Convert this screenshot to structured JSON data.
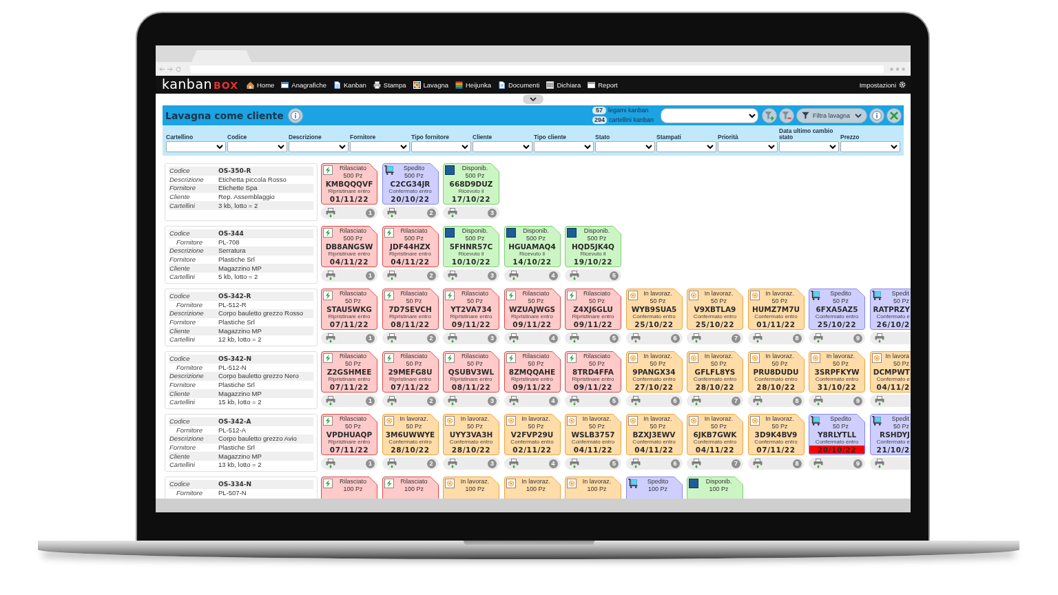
{
  "nav": {
    "logo": {
      "text": "kanban",
      "accent": "BOX"
    },
    "items": [
      {
        "kind": "home",
        "label": "Home"
      },
      {
        "kind": "registry",
        "label": "Anagrafiche"
      },
      {
        "kind": "kanban",
        "label": "Kanban"
      },
      {
        "kind": "print",
        "label": "Stampa"
      },
      {
        "kind": "board",
        "label": "Lavagna"
      },
      {
        "kind": "heijunka",
        "label": "Heijunka"
      },
      {
        "kind": "documents",
        "label": "Documenti"
      },
      {
        "kind": "declare",
        "label": "Dichiara"
      },
      {
        "kind": "report",
        "label": "Report"
      }
    ],
    "settings": {
      "label": "Impostazioni"
    }
  },
  "panel": {
    "title": "Lavagna come cliente",
    "counters": [
      {
        "count": "57",
        "text": "legami kanban"
      },
      {
        "count": "294",
        "text": "cartellini kanban"
      }
    ],
    "filter_button": {
      "label": "Filtra lavagna"
    },
    "filters": [
      {
        "label": "Cartellino"
      },
      {
        "label": "Codice"
      },
      {
        "label": "Descrizione"
      },
      {
        "label": "Fornitore"
      },
      {
        "label": "Tipo fornitore"
      },
      {
        "label": "Cliente"
      },
      {
        "label": "Tipo cliente"
      },
      {
        "label": "Stato"
      },
      {
        "label": "Stampati"
      },
      {
        "label": "Priorità"
      },
      {
        "label": "Data ultimo cambio stato"
      },
      {
        "label": "Prezzo"
      }
    ]
  },
  "rows": [
    {
      "fields": [
        {
          "label": "Codice",
          "value": "OS-350-R",
          "indented": false
        },
        {
          "label": "Descrizione",
          "value": "Etichetta piccola Rosso",
          "indented": false
        },
        {
          "label": "Fornitore",
          "value": "Etichette Spa",
          "indented": false
        },
        {
          "label": "Cliente",
          "value": "Rep. Assemblaggio",
          "indented": false
        },
        {
          "label": "Cartellini",
          "value": "3 kb, lotto = 2",
          "indented": false
        }
      ],
      "cards": [
        {
          "kind": "released",
          "status": "Rilasciato",
          "quantity": "500 Pz",
          "code": "KMBQQQVF",
          "date_label": "Ripristinare entro",
          "date": "01/11/22",
          "overdue": false,
          "number": "1"
        },
        {
          "kind": "shipped",
          "status": "Spedito",
          "quantity": "500 Pz",
          "code": "C2CG34JR",
          "date_label": "Confermato entro",
          "date": "20/10/22",
          "overdue": false,
          "number": "2"
        },
        {
          "kind": "available",
          "status": "Disponib.",
          "quantity": "500 Pz",
          "code": "668D9DUZ",
          "date_label": "Ricevuto il",
          "date": "17/10/22",
          "overdue": false,
          "number": "3"
        }
      ]
    },
    {
      "fields": [
        {
          "label": "Codice",
          "value": "OS-344",
          "indented": false
        },
        {
          "label": "Fornitore",
          "value": "PL-708",
          "indented": true
        },
        {
          "label": "Descrizione",
          "value": "Serratura",
          "indented": false
        },
        {
          "label": "Fornitore",
          "value": "Plastiche Srl",
          "indented": false
        },
        {
          "label": "Cliente",
          "value": "Magazzino MP",
          "indented": false
        },
        {
          "label": "Cartellini",
          "value": "5 kb, lotto = 2",
          "indented": false
        }
      ],
      "cards": [
        {
          "kind": "released",
          "status": "Rilasciato",
          "quantity": "500 Pz",
          "code": "DB8ANGSW",
          "date_label": "Ripristinare entro",
          "date": "04/11/22",
          "overdue": false,
          "number": "1"
        },
        {
          "kind": "released",
          "status": "Rilasciato",
          "quantity": "500 Pz",
          "code": "JDF44HZX",
          "date_label": "Ripristinare entro",
          "date": "04/11/22",
          "overdue": false,
          "number": "2"
        },
        {
          "kind": "available",
          "status": "Disponib.",
          "quantity": "500 Pz",
          "code": "5FHNR57C",
          "date_label": "Ricevuto il",
          "date": "10/10/22",
          "overdue": false,
          "number": "3"
        },
        {
          "kind": "available",
          "status": "Disponib.",
          "quantity": "500 Pz",
          "code": "HGUAMAQ4",
          "date_label": "Ricevuto il",
          "date": "14/10/22",
          "overdue": false,
          "number": "4"
        },
        {
          "kind": "available",
          "status": "Disponib.",
          "quantity": "500 Pz",
          "code": "HQD5JK4Q",
          "date_label": "Ricevuto il",
          "date": "19/10/22",
          "overdue": false,
          "number": "5"
        }
      ]
    },
    {
      "fields": [
        {
          "label": "Codice",
          "value": "OS-342-R",
          "indented": false
        },
        {
          "label": "Fornitore",
          "value": "PL-512-R",
          "indented": true
        },
        {
          "label": "Descrizione",
          "value": "Corpo bauletto grezzo Rosso",
          "indented": false
        },
        {
          "label": "Fornitore",
          "value": "Plastiche Srl",
          "indented": false
        },
        {
          "label": "Cliente",
          "value": "Magazzino MP",
          "indented": false
        },
        {
          "label": "Cartellini",
          "value": "12 kb, lotto = 2",
          "indented": false
        }
      ],
      "cards": [
        {
          "kind": "released",
          "status": "Rilasciato",
          "quantity": "50 Pz",
          "code": "STAU5WKG",
          "date_label": "Ripristinare entro",
          "date": "07/11/22",
          "overdue": false,
          "number": "1"
        },
        {
          "kind": "released",
          "status": "Rilasciato",
          "quantity": "50 Pz",
          "code": "7D7SEVCH",
          "date_label": "Ripristinare entro",
          "date": "08/11/22",
          "overdue": false,
          "number": "2"
        },
        {
          "kind": "released",
          "status": "Rilasciato",
          "quantity": "50 Pz",
          "code": "YT2VA734",
          "date_label": "Ripristinare entro",
          "date": "09/11/22",
          "overdue": false,
          "number": "3"
        },
        {
          "kind": "released",
          "status": "Rilasciato",
          "quantity": "50 Pz",
          "code": "WZUAJWGS",
          "date_label": "Ripristinare entro",
          "date": "09/11/22",
          "overdue": false,
          "number": "4"
        },
        {
          "kind": "released",
          "status": "Rilasciato",
          "quantity": "50 Pz",
          "code": "Z4XJ6GLU",
          "date_label": "Ripristinare entro",
          "date": "09/11/22",
          "overdue": false,
          "number": "5"
        },
        {
          "kind": "wip",
          "status": "In lavoraz.",
          "quantity": "50 Pz",
          "code": "WYB9SUA5",
          "date_label": "Confermato entro",
          "date": "25/10/22",
          "overdue": false,
          "number": "6"
        },
        {
          "kind": "wip",
          "status": "In lavoraz.",
          "quantity": "50 Pz",
          "code": "V9XBTLA9",
          "date_label": "Confermato entro",
          "date": "25/10/22",
          "overdue": false,
          "number": "7"
        },
        {
          "kind": "wip",
          "status": "In lavoraz.",
          "quantity": "50 Pz",
          "code": "HUMZ7M7U",
          "date_label": "Confermato entro",
          "date": "01/11/22",
          "overdue": false,
          "number": "8"
        },
        {
          "kind": "shipped",
          "status": "Spedito",
          "quantity": "50 Pz",
          "code": "6FXA5AZ5",
          "date_label": "Confermato entro",
          "date": "25/10/22",
          "overdue": false,
          "number": "9"
        },
        {
          "kind": "shipped",
          "status": "Spedit",
          "quantity": "50 Pz",
          "code": "RATPRZY",
          "date_label": "Confermato e",
          "date": "26/10/2",
          "overdue": false
        }
      ]
    },
    {
      "fields": [
        {
          "label": "Codice",
          "value": "OS-342-N",
          "indented": false
        },
        {
          "label": "Fornitore",
          "value": "PL-512-N",
          "indented": true
        },
        {
          "label": "Descrizione",
          "value": "Corpo bauletto grezzo Nero",
          "indented": false
        },
        {
          "label": "Fornitore",
          "value": "Plastiche Srl",
          "indented": false
        },
        {
          "label": "Cliente",
          "value": "Magazzino MP",
          "indented": false
        },
        {
          "label": "Cartellini",
          "value": "15 kb, lotto = 2",
          "indented": false
        }
      ],
      "cards": [
        {
          "kind": "released",
          "status": "Rilasciato",
          "quantity": "50 Pz",
          "code": "Z2GSHMEE",
          "date_label": "Ripristinare entro",
          "date": "07/11/22",
          "overdue": false,
          "number": "1"
        },
        {
          "kind": "released",
          "status": "Rilasciato",
          "quantity": "50 Pz",
          "code": "29MEFG8U",
          "date_label": "Ripristinare entro",
          "date": "07/11/22",
          "overdue": false,
          "number": "2"
        },
        {
          "kind": "released",
          "status": "Rilasciato",
          "quantity": "50 Pz",
          "code": "QSUBV3WL",
          "date_label": "Ripristinare entro",
          "date": "08/11/22",
          "overdue": false,
          "number": "3"
        },
        {
          "kind": "released",
          "status": "Rilasciato",
          "quantity": "50 Pz",
          "code": "8ZMQQAHE",
          "date_label": "Ripristinare entro",
          "date": "09/11/22",
          "overdue": false,
          "number": "4"
        },
        {
          "kind": "released",
          "status": "Rilasciato",
          "quantity": "50 Pz",
          "code": "8TRD4FFA",
          "date_label": "Ripristinare entro",
          "date": "09/11/22",
          "overdue": false,
          "number": "5"
        },
        {
          "kind": "wip",
          "status": "In lavoraz.",
          "quantity": "50 Pz",
          "code": "9PANGX34",
          "date_label": "Confermato entro",
          "date": "27/10/22",
          "overdue": false,
          "number": "6"
        },
        {
          "kind": "wip",
          "status": "In lavoraz.",
          "quantity": "50 Pz",
          "code": "GFLFL8YS",
          "date_label": "Confermato entro",
          "date": "28/10/22",
          "overdue": false,
          "number": "7"
        },
        {
          "kind": "wip",
          "status": "In lavoraz.",
          "quantity": "50 Pz",
          "code": "PRU8DUDU",
          "date_label": "Confermato entro",
          "date": "28/10/22",
          "overdue": false,
          "number": "8"
        },
        {
          "kind": "wip",
          "status": "In lavoraz.",
          "quantity": "50 Pz",
          "code": "3SRPFKYW",
          "date_label": "Confermato entro",
          "date": "31/10/22",
          "overdue": false,
          "number": "9"
        },
        {
          "kind": "wip",
          "status": "In lavora",
          "quantity": "50 Pz",
          "code": "DCMPWT",
          "date_label": "Confermato e",
          "date": "04/11/2",
          "overdue": false
        }
      ]
    },
    {
      "fields": [
        {
          "label": "Codice",
          "value": "OS-342-A",
          "indented": false
        },
        {
          "label": "Fornitore",
          "value": "PL-512-A",
          "indented": true
        },
        {
          "label": "Descrizione",
          "value": "Corpo bauletto grezzo Avio",
          "indented": false
        },
        {
          "label": "Fornitore",
          "value": "Plastiche Srl",
          "indented": false
        },
        {
          "label": "Cliente",
          "value": "Magazzino MP",
          "indented": false
        },
        {
          "label": "Cartellini",
          "value": "13 kb, lotto = 2",
          "indented": false
        }
      ],
      "cards": [
        {
          "kind": "released",
          "status": "Rilasciato",
          "quantity": "50 Pz",
          "code": "VPDHUAQP",
          "date_label": "Ripristinare entro",
          "date": "07/11/22",
          "overdue": false,
          "number": "1"
        },
        {
          "kind": "wip",
          "status": "In lavoraz.",
          "quantity": "50 Pz",
          "code": "3M6UWWYE",
          "date_label": "Confermato entro",
          "date": "28/10/22",
          "overdue": false,
          "number": "2"
        },
        {
          "kind": "wip",
          "status": "In lavoraz.",
          "quantity": "50 Pz",
          "code": "UYY3VA3H",
          "date_label": "Confermato entro",
          "date": "28/10/22",
          "overdue": false,
          "number": "3"
        },
        {
          "kind": "wip",
          "status": "In lavoraz.",
          "quantity": "50 Pz",
          "code": "V2FVP29U",
          "date_label": "Confermato entro",
          "date": "02/11/22",
          "overdue": false,
          "number": "4"
        },
        {
          "kind": "wip",
          "status": "In lavoraz.",
          "quantity": "50 Pz",
          "code": "WSLB3757",
          "date_label": "Confermato entro",
          "date": "04/11/22",
          "overdue": false,
          "number": "5"
        },
        {
          "kind": "wip",
          "status": "In lavoraz.",
          "quantity": "50 Pz",
          "code": "BZXJ3EWV",
          "date_label": "Confermato entro",
          "date": "04/11/22",
          "overdue": false,
          "number": "6"
        },
        {
          "kind": "wip",
          "status": "In lavoraz.",
          "quantity": "50 Pz",
          "code": "6JKB7GWK",
          "date_label": "Confermato entro",
          "date": "04/11/22",
          "overdue": false,
          "number": "7"
        },
        {
          "kind": "wip",
          "status": "In lavoraz.",
          "quantity": "50 Pz",
          "code": "3D9K4BV9",
          "date_label": "Confermato entro",
          "date": "07/11/22",
          "overdue": false,
          "number": "8"
        },
        {
          "kind": "shipped",
          "status": "Spedito",
          "quantity": "50 Pz",
          "code": "Y8RLYTLL",
          "date_label": "Confermato entro",
          "date": "20/10/22",
          "overdue": true,
          "number": "9"
        },
        {
          "kind": "shipped",
          "status": "Spedit",
          "quantity": "50 Pz",
          "code": "RSHDYJ",
          "date_label": "Confermato e",
          "date": "21/10/2",
          "overdue": false
        }
      ]
    },
    {
      "fields": [
        {
          "label": "Codice",
          "value": "OS-334-N",
          "indented": false
        },
        {
          "label": "Fornitore",
          "value": "PL-507-N",
          "indented": true
        }
      ],
      "cards": [
        {
          "kind": "released",
          "status": "Rilasciato",
          "quantity": "100 Pz"
        },
        {
          "kind": "released",
          "status": "Rilasciato",
          "quantity": "100 Pz"
        },
        {
          "kind": "wip",
          "status": "In lavoraz.",
          "quantity": "100 Pz"
        },
        {
          "kind": "wip",
          "status": "In lavoraz.",
          "quantity": "100 Pz"
        },
        {
          "kind": "wip",
          "status": "In lavoraz.",
          "quantity": "100 Pz"
        },
        {
          "kind": "shipped",
          "status": "Spedito",
          "quantity": "100 Pz"
        },
        {
          "kind": "available",
          "status": "Disponib.",
          "quantity": "100 Pz"
        }
      ]
    }
  ]
}
